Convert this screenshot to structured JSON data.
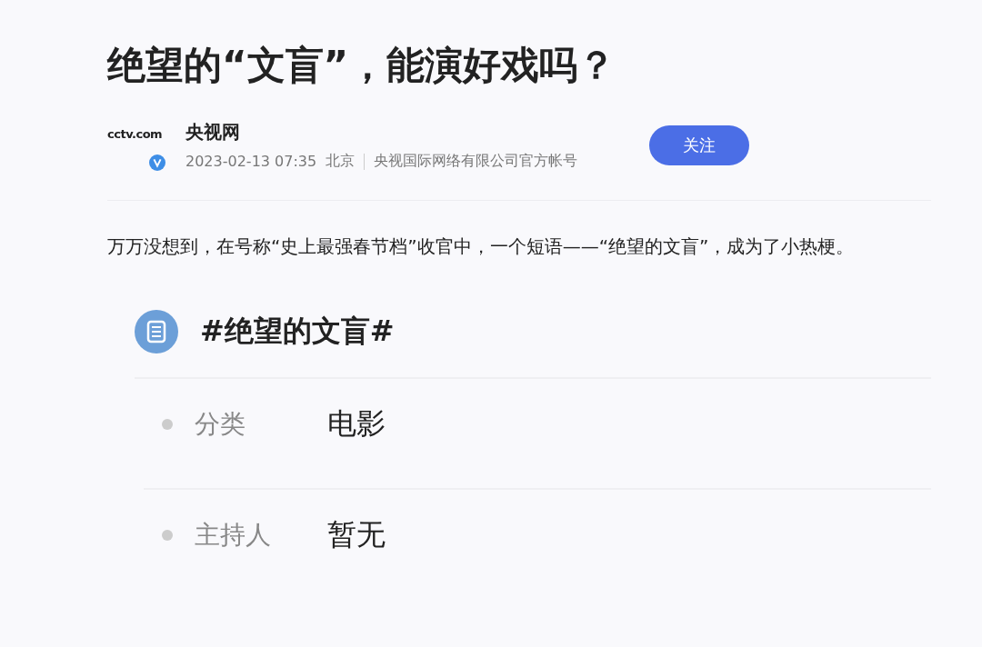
{
  "article": {
    "title": "绝望的“文盲”，能演好戏吗？"
  },
  "author": {
    "logo_text": "cctv.com",
    "verified": true,
    "name": "央视网",
    "datetime": "2023-02-13 07:35",
    "location": "北京",
    "description": "央视国际网络有限公司官方帐号",
    "follow_label": "关注"
  },
  "paragraph": "万万没想到，在号称“史上最强春节档”收官中，一个短语——“绝望的文盲”，成为了小热梗。",
  "topic": {
    "title": "#绝望的文盲#",
    "rows": [
      {
        "label": "分类",
        "value": "电影"
      },
      {
        "label": "主持人",
        "value": "暂无"
      }
    ]
  }
}
